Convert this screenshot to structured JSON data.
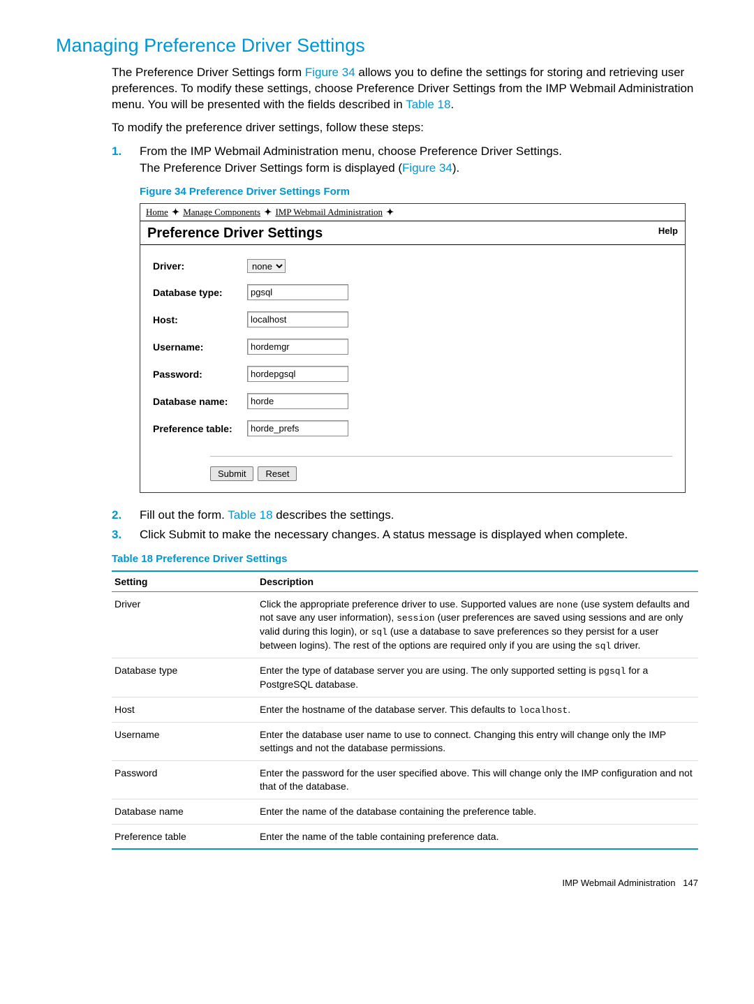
{
  "heading": "Managing Preference Driver Settings",
  "intro_parts": {
    "p1a": "The Preference Driver Settings form ",
    "figref1": "Figure 34",
    "p1b": " allows you to define the settings for storing and retrieving user preferences. To modify these settings, choose Preference Driver Settings from the IMP Webmail Administration menu. You will be presented with the fields described in ",
    "tabref1": "Table 18",
    "p1c": "."
  },
  "modify_line": "To modify the preference driver settings, follow these steps:",
  "steps": {
    "s1": {
      "num": "1.",
      "text": "From the IMP Webmail Administration menu, choose Preference Driver Settings.",
      "sub_a": "The Preference Driver Settings form is displayed (",
      "sub_link": "Figure 34",
      "sub_b": ")."
    },
    "s2": {
      "num": "2.",
      "a": "Fill out the form. ",
      "link": "Table 18",
      "b": " describes the settings."
    },
    "s3": {
      "num": "3.",
      "text": "Click Submit to make the necessary changes. A status message is displayed when complete."
    }
  },
  "figure_caption": "Figure 34 Preference Driver Settings Form",
  "table_caption": "Table 18 Preference Driver Settings",
  "screenshot": {
    "breadcrumb": {
      "home": "Home",
      "manage": "Manage Components",
      "imp": "IMP Webmail Administration"
    },
    "title": "Preference Driver Settings",
    "help": "Help",
    "labels": {
      "driver": "Driver:",
      "dbtype": "Database type:",
      "host": "Host:",
      "username": "Username:",
      "password": "Password:",
      "dbname": "Database name:",
      "preftable": "Preference table:"
    },
    "values": {
      "driver": "none",
      "dbtype": "pgsql",
      "host": "localhost",
      "username": "hordemgr",
      "password": "hordepgsql",
      "dbname": "horde",
      "preftable": "horde_prefs"
    },
    "buttons": {
      "submit": "Submit",
      "reset": "Reset"
    }
  },
  "table": {
    "headers": {
      "setting": "Setting",
      "desc": "Description"
    },
    "rows": {
      "r0": {
        "setting": "Driver",
        "d1": "Click the appropriate preference driver to use. Supported values are ",
        "m1": "none",
        "d2": " (use system defaults and not save any user information), ",
        "m2": "session",
        "d3": " (user preferences are saved using sessions and are only valid during this login), or ",
        "m3": "sql",
        "d4": " (use a database to save preferences so they persist for a user between logins). The rest of the options are required only if you are using the ",
        "m4": "sql",
        "d5": " driver."
      },
      "r1": {
        "setting": "Database type",
        "d1": "Enter the type of database server you are using. The only supported setting is ",
        "m1": "pgsql",
        "d2": " for a PostgreSQL database."
      },
      "r2": {
        "setting": "Host",
        "d1": "Enter the hostname of the database server. This defaults to ",
        "m1": "localhost",
        "d2": "."
      },
      "r3": {
        "setting": "Username",
        "desc": "Enter the database user name to use to connect. Changing this entry will change only the IMP settings and not the database permissions."
      },
      "r4": {
        "setting": "Password",
        "desc": "Enter the password for the user specified above. This will change only the IMP configuration and not that of the database."
      },
      "r5": {
        "setting": "Database name",
        "desc": "Enter the name of the database containing the preference table."
      },
      "r6": {
        "setting": "Preference table",
        "desc": "Enter the name of the table containing preference data."
      }
    }
  },
  "footer": {
    "text": "IMP Webmail Administration",
    "page": "147"
  }
}
